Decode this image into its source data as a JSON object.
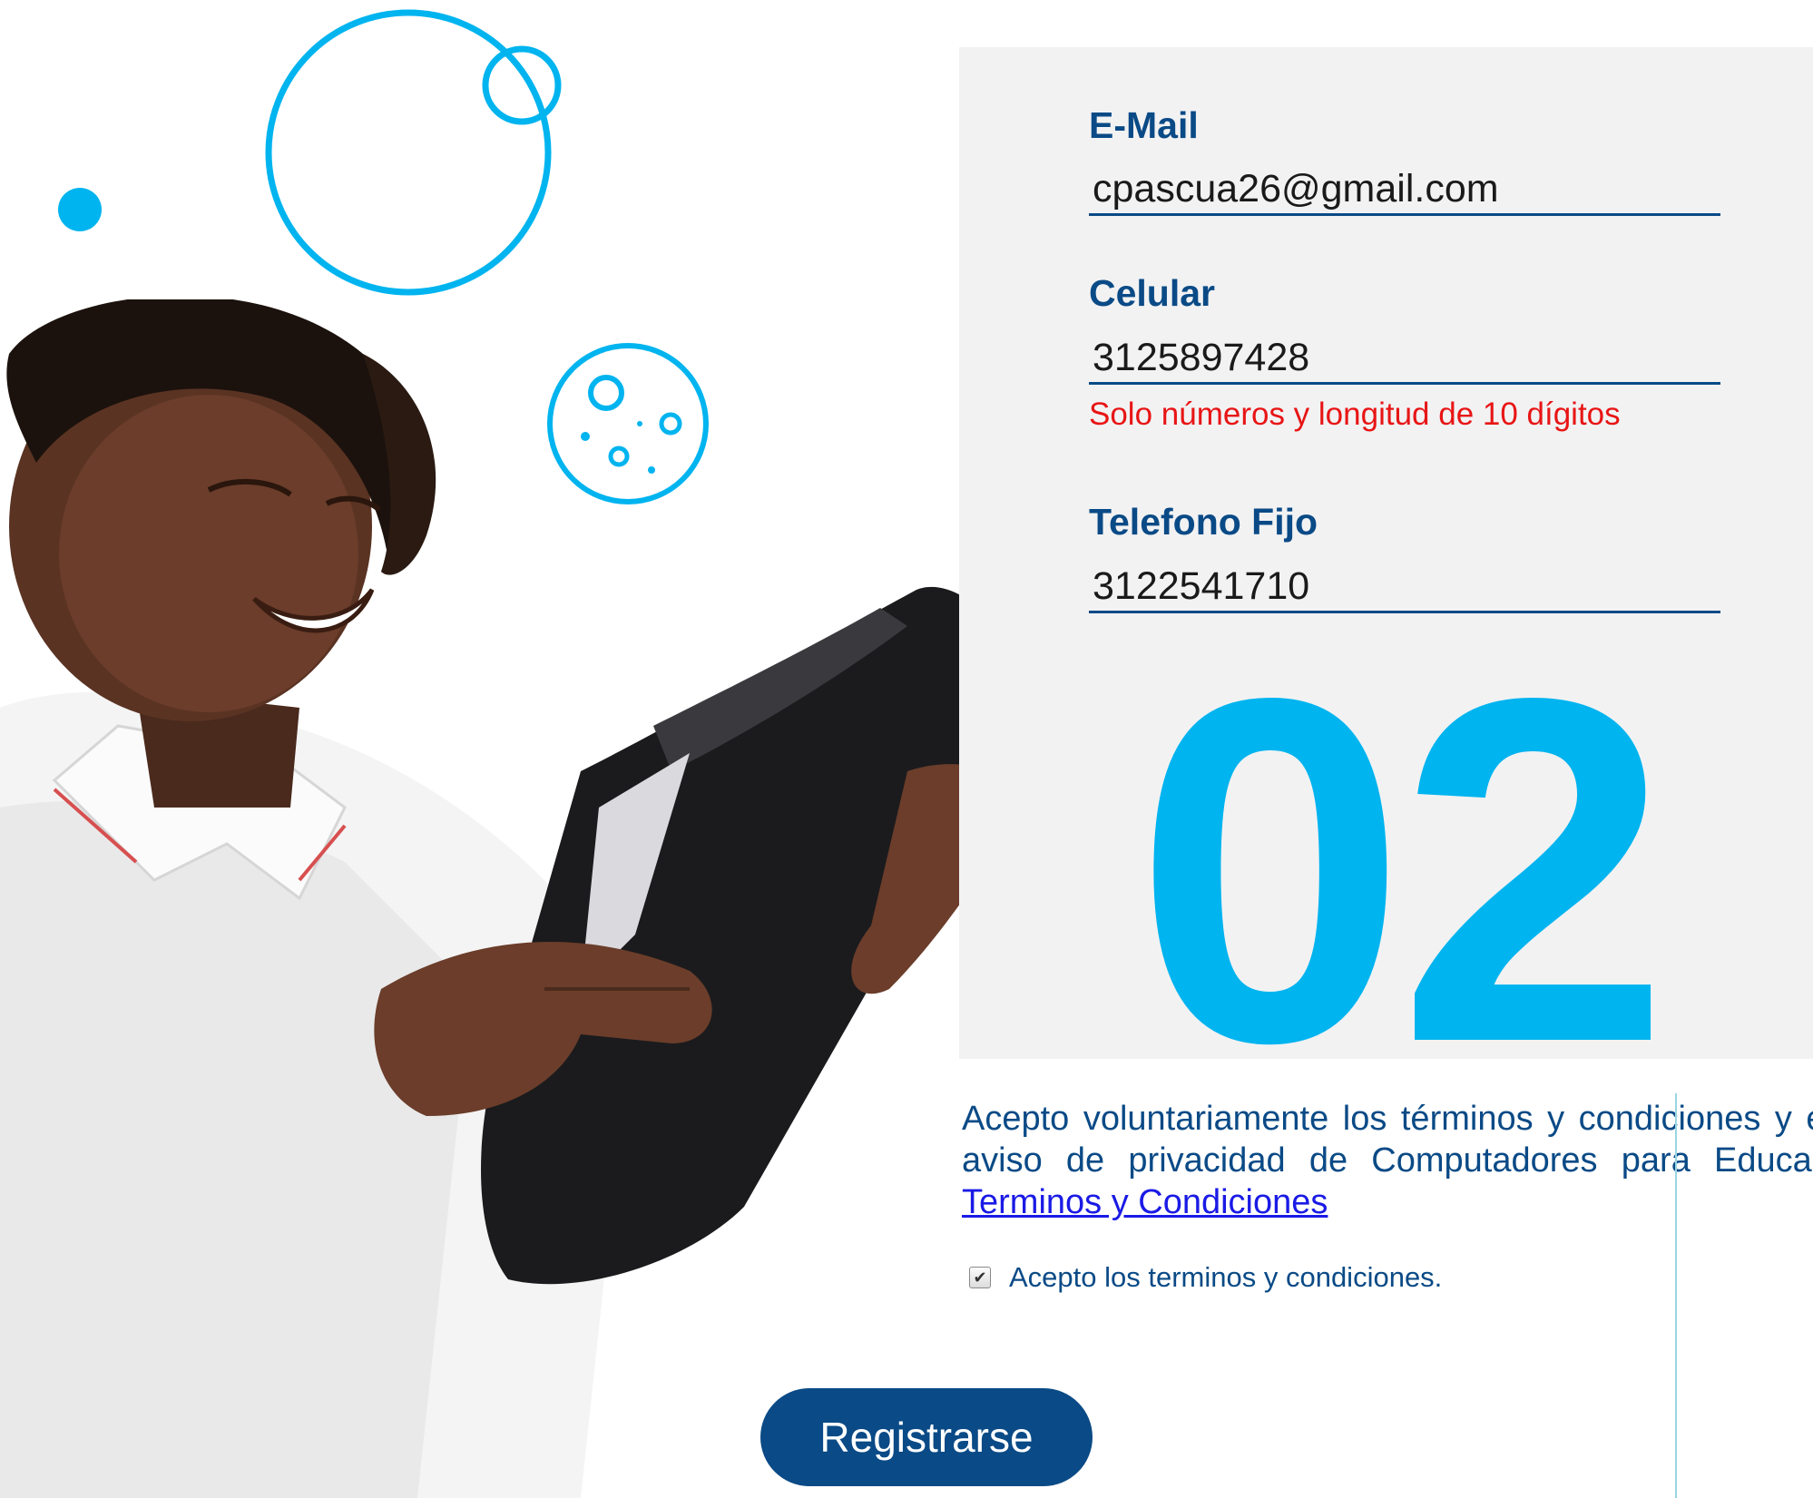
{
  "colors": {
    "accent": "#00b4ef",
    "primary": "#0a4a86",
    "error": "#e81515",
    "panel": "#f2f2f3",
    "link": "#1a1ae6"
  },
  "form": {
    "email": {
      "label": "E-Mail",
      "value": "cpascua26@gmail.com"
    },
    "celular": {
      "label": "Celular",
      "value": "3125897428",
      "error": "Solo números y longitud de 10 dígitos"
    },
    "telefono": {
      "label": "Telefono Fijo",
      "value": "3122541710"
    }
  },
  "step_number": "02",
  "terms": {
    "text": "Acepto voluntariamente los términos y condiciones y el aviso de privacidad de Computadores para Educar: ",
    "link_label": "Terminos y Condiciones",
    "checkbox_checked": true,
    "checkbox_label": "Acepto los terminos y condiciones."
  },
  "register_button_label": "Registrarse",
  "icons": {
    "bubbles": "bubbles-icon",
    "planet": "planet-icon",
    "dot": "dot-icon",
    "checkbox": "checkbox-icon"
  }
}
